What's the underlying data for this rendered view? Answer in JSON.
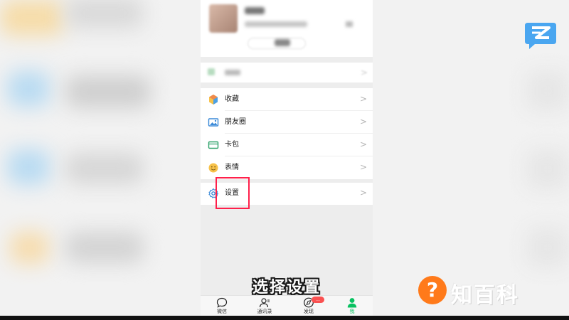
{
  "menu": {
    "items": [
      {
        "label": "收藏",
        "icon": "favorites-cube-icon"
      },
      {
        "label": "朋友圈",
        "icon": "moments-picture-icon"
      },
      {
        "label": "卡包",
        "icon": "card-wallet-icon"
      },
      {
        "label": "表情",
        "icon": "sticker-smile-icon"
      }
    ],
    "settings_label": "设置",
    "arrow": ">"
  },
  "subtitle": "选择设置",
  "tabbar": {
    "tabs": [
      {
        "label": "微信",
        "icon": "chat-bubble-icon"
      },
      {
        "label": "通讯录",
        "icon": "contacts-icon"
      },
      {
        "label": "发现",
        "icon": "discover-compass-icon",
        "badge": "..."
      },
      {
        "label": "我",
        "icon": "me-person-icon",
        "active": true
      }
    ]
  },
  "watermark": {
    "brand_text": "知百科",
    "brand_mark": "?"
  },
  "colors": {
    "accent_green": "#07c160",
    "highlight_red": "#ff1f4a",
    "badge_red": "#fa5151",
    "logo_orange": "#ff7a1a",
    "logo_blue": "#4aa6f0"
  }
}
